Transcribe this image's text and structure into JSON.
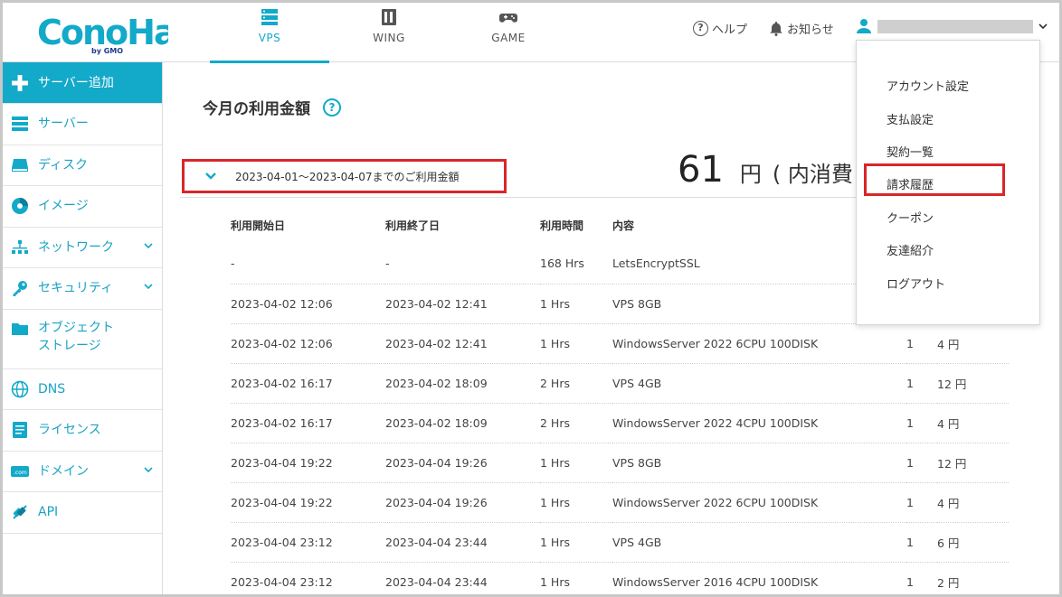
{
  "brand": {
    "logo_text": "ConoHa",
    "logo_sub": "by GMO",
    "accent": "#13a9c9",
    "highlight": "#d9262a"
  },
  "header": {
    "tabs": [
      {
        "label": "VPS",
        "icon": "server-icon",
        "active": true
      },
      {
        "label": "WING",
        "icon": "building-icon",
        "active": false
      },
      {
        "label": "GAME",
        "icon": "gamepad-icon",
        "active": false
      }
    ],
    "help_label": "ヘルプ",
    "news_label": "お知らせ"
  },
  "sidebar": {
    "items": [
      {
        "label": "サーバー追加",
        "icon": "plus-icon"
      },
      {
        "label": "サーバー",
        "icon": "server-icon"
      },
      {
        "label": "ディスク",
        "icon": "disk-icon"
      },
      {
        "label": "イメージ",
        "icon": "image-icon"
      },
      {
        "label": "ネットワーク",
        "icon": "network-icon"
      },
      {
        "label": "セキュリティ",
        "icon": "key-icon"
      },
      {
        "label": "オブジェクト",
        "label2": "ストレージ",
        "icon": "folder-icon"
      },
      {
        "label": "DNS",
        "icon": "globe-icon"
      },
      {
        "label": "ライセンス",
        "icon": "license-icon"
      },
      {
        "label": "ドメイン",
        "icon": "domain-icon"
      },
      {
        "label": "API",
        "icon": "api-icon"
      }
    ]
  },
  "main": {
    "title": "今月の利用金額",
    "period_label": "2023-04-01～2023-04-07までのご利用金額",
    "amount_value": "61",
    "amount_unit": "円",
    "amount_tax": "( 内消費",
    "table": {
      "headers": [
        "利用開始日",
        "利用終了日",
        "利用時間",
        "内容",
        "",
        ""
      ],
      "rows": [
        [
          "-",
          "-",
          "168 Hrs",
          "LetsEncryptSSL",
          "",
          ""
        ],
        [
          "2023-04-02 12:06",
          "2023-04-02 12:41",
          "1 Hrs",
          "VPS 8GB",
          "",
          ""
        ],
        [
          "2023-04-02 12:06",
          "2023-04-02 12:41",
          "1 Hrs",
          "WindowsServer 2022 6CPU 100DISK",
          "1",
          "4 円"
        ],
        [
          "2023-04-02 16:17",
          "2023-04-02 18:09",
          "2 Hrs",
          "VPS 4GB",
          "1",
          "12 円"
        ],
        [
          "2023-04-02 16:17",
          "2023-04-02 18:09",
          "2 Hrs",
          "WindowsServer 2022 4CPU 100DISK",
          "1",
          "4 円"
        ],
        [
          "2023-04-04 19:22",
          "2023-04-04 19:26",
          "1 Hrs",
          "VPS 8GB",
          "1",
          "12 円"
        ],
        [
          "2023-04-04 19:22",
          "2023-04-04 19:26",
          "1 Hrs",
          "WindowsServer 2022 6CPU 100DISK",
          "1",
          "4 円"
        ],
        [
          "2023-04-04 23:12",
          "2023-04-04 23:44",
          "1 Hrs",
          "VPS 4GB",
          "1",
          "6 円"
        ],
        [
          "2023-04-04 23:12",
          "2023-04-04 23:44",
          "1 Hrs",
          "WindowsServer 2016 4CPU 100DISK",
          "1",
          "2 円"
        ]
      ]
    }
  },
  "account_menu": {
    "items": [
      "アカウント設定",
      "支払設定",
      "契約一覧",
      "請求履歴",
      "クーポン",
      "友達紹介",
      "ログアウト"
    ],
    "highlighted": "請求履歴"
  }
}
